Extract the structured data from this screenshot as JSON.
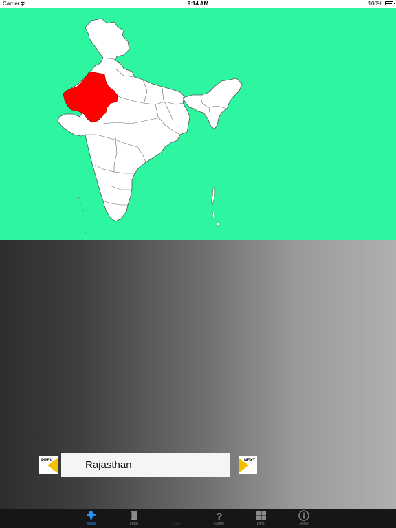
{
  "status_bar": {
    "carrier": "Carrier",
    "time": "9:14 AM",
    "battery": "100%"
  },
  "map": {
    "background": "#2ef5a0",
    "highlight_color": "#ff0000",
    "highlighted_state": "Rajasthan"
  },
  "navigator": {
    "prev_label": "PREV",
    "next_label": "NEXT",
    "current_state": "Rajasthan"
  },
  "tab_bar": {
    "tabs": [
      {
        "label": "Maps",
        "icon": "india-map-icon",
        "state": "active"
      },
      {
        "label": "Flags",
        "icon": "flag-book-icon",
        "state": "normal"
      },
      {
        "label": "GDA",
        "icon": "gda-icon",
        "state": "disabled"
      },
      {
        "label": "Game",
        "icon": "question-mark-icon",
        "state": "normal"
      },
      {
        "label": "Other",
        "icon": "grid-icon",
        "state": "normal"
      },
      {
        "label": "About",
        "icon": "info-icon",
        "state": "normal"
      }
    ]
  }
}
